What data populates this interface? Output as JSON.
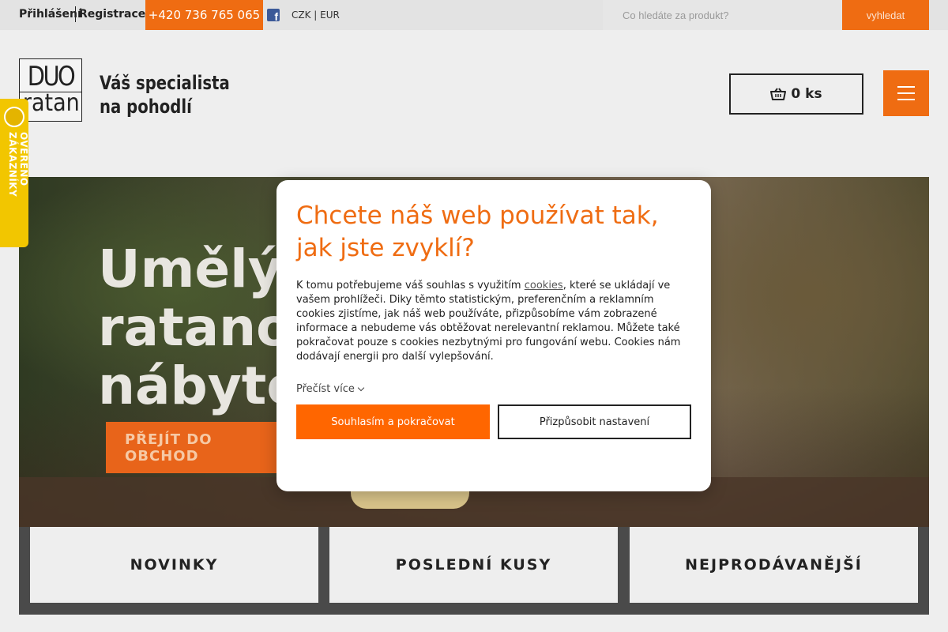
{
  "topbar": {
    "login": "Přihlášení",
    "register": "Registrace",
    "phone": "+420 736 765 065",
    "facebook_icon": "facebook-icon",
    "currency": "CZK | EUR",
    "search_placeholder": "Co hledáte za produkt?",
    "search_button": "vyhledat"
  },
  "header": {
    "logo_top": "DUO",
    "logo_bottom": "ratan",
    "tagline_line1": "Váš specialista",
    "tagline_line2": "na pohodlí",
    "cart_icon": "basket-icon",
    "cart_label": "0 ks",
    "menu_icon": "hamburger-menu-icon"
  },
  "trust_badge": {
    "text": "OVĚŘENO ZÁKAZNÍKY"
  },
  "hero": {
    "heading_line1": "Umělý",
    "heading_line2": "ratano",
    "heading_line3": "nábyto",
    "button": "PŘEJÍT DO OBCHOD"
  },
  "categories": [
    {
      "label": "NOVINKY"
    },
    {
      "label": "POSLEDNÍ KUSY"
    },
    {
      "label": "NEJPRODÁVANĚJŠÍ"
    }
  ],
  "cookie_modal": {
    "title": "Chcete náš web používat tak, jak jste zvyklí?",
    "text_before_link": "K tomu potřebujeme váš souhlas s využitím ",
    "link_text": "cookies",
    "text_after_link": ", které se ukládají ve vašem prohlížeči. Diky těmto statistickým, preferenčním a reklamním cookies zjistíme, jak náš web používáte, přizpůsobíme vám zobrazené informace a nebudeme vás obtěžovat nerelevantní reklamou. Můžete také pokračovat pouze s cookies nezbytnými pro fungování webu. Cookies nám dodávají energii pro další vylepšování.",
    "read_more": "Přečíst více",
    "accept_button": "Souhlasím a pokračovat",
    "customize_button": "Přizpůsobit nastavení"
  },
  "colors": {
    "accent": "#ef6c12",
    "badge": "#f2c600"
  }
}
